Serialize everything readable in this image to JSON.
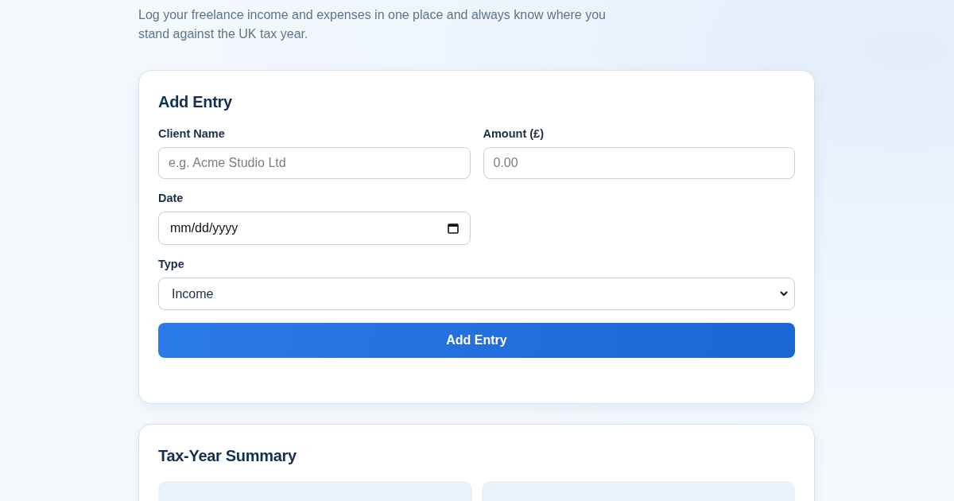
{
  "intro": "Log your freelance income and expenses in one place and always know where you stand against the UK tax year.",
  "entry_form": {
    "title": "Add Entry",
    "fields": [
      {
        "kind": "text",
        "label": "Client Name",
        "placeholder": "e.g. Acme Studio Ltd"
      },
      {
        "kind": "text",
        "label": "Amount (£)",
        "placeholder": "0.00"
      },
      {
        "kind": "date",
        "label": "Date",
        "placeholder": "mm/dd/yyyy"
      },
      {
        "kind": "select",
        "label": "Type",
        "value": "Income"
      }
    ],
    "button": "Add Entry"
  },
  "summary": {
    "title": "Tax-Year Summary",
    "tiles": [
      {
        "kind": "tile"
      },
      {
        "kind": "tile"
      }
    ]
  }
}
